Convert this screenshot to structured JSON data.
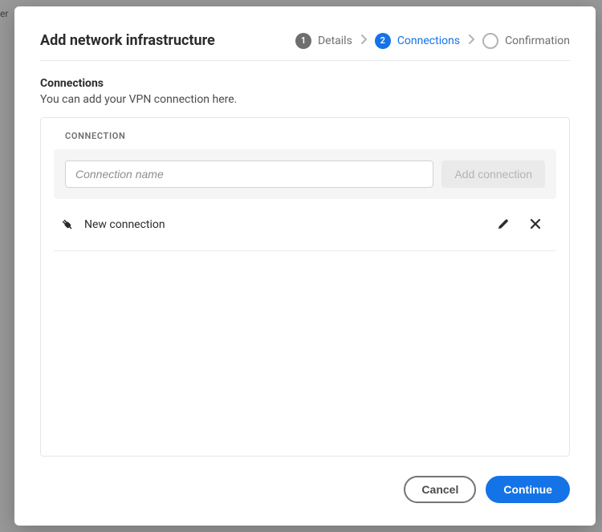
{
  "bg_fragment": "er",
  "modal": {
    "title": "Add network infrastructure",
    "stepper": {
      "step1": {
        "num": "1",
        "label": "Details"
      },
      "step2": {
        "num": "2",
        "label": "Connections"
      },
      "step3": {
        "num": "",
        "label": "Confirmation"
      }
    },
    "section": {
      "title": "Connections",
      "desc": "You can add your VPN connection here."
    },
    "panel": {
      "label": "CONNECTION",
      "input_placeholder": "Connection name",
      "add_button": "Add connection",
      "items": [
        {
          "name": "New connection"
        }
      ]
    },
    "footer": {
      "cancel": "Cancel",
      "continue": "Continue"
    }
  }
}
